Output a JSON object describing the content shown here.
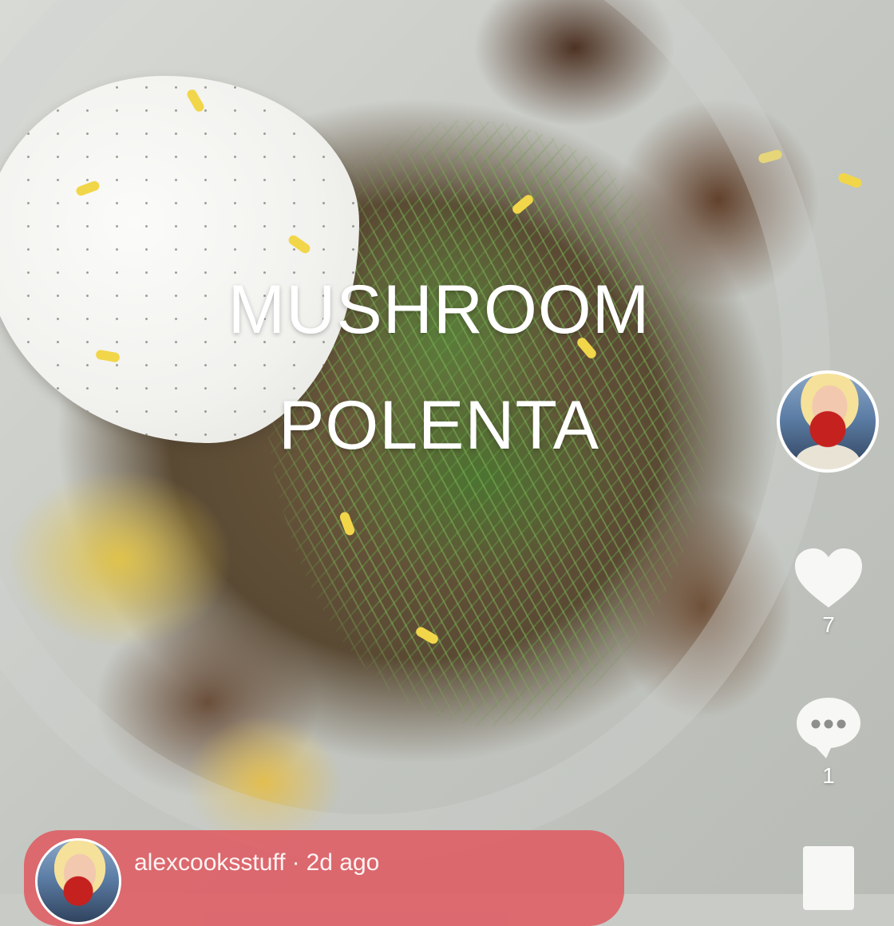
{
  "post": {
    "title_line1": "MUSHROOM",
    "title_line2": "POLENTA"
  },
  "sidebar": {
    "avatar_icon": "profile-photo",
    "like": {
      "icon": "heart-icon",
      "count": "7"
    },
    "comment": {
      "icon": "comment-bubble-icon",
      "count": "1"
    },
    "bookmark": {
      "icon": "bookmark-icon"
    }
  },
  "author": {
    "username": "alexcooksstuff",
    "separator": "·",
    "posted_ago": "2d ago"
  },
  "colors": {
    "userbar_bg": "#e0545c",
    "overlay_text": "#ffffff",
    "icon_fill": "#f7f7f5"
  }
}
